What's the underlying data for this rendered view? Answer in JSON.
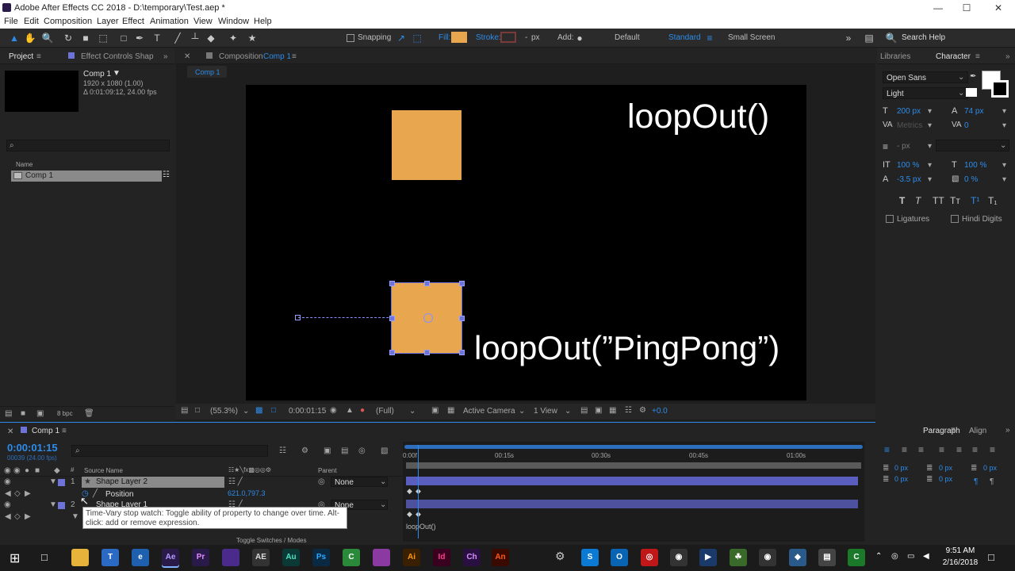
{
  "window": {
    "title": "Adobe After Effects CC 2018 - D:\\temporary\\Test.aep *",
    "min": "—",
    "max": "☐",
    "close": "✕"
  },
  "menu": [
    "File",
    "Edit",
    "Composition",
    "Layer",
    "Effect",
    "Animation",
    "View",
    "Window",
    "Help"
  ],
  "toolbar": {
    "snapping": "Snapping",
    "fill": "Fill:",
    "stroke": "Stroke:",
    "px": "px",
    "add": "Add:",
    "workspaces": [
      "Default",
      "Standard",
      "Small Screen"
    ],
    "active_workspace": "Standard",
    "search_help": "Search Help",
    "fill_color": "#e8a74e"
  },
  "project": {
    "tab_project": "Project",
    "tab_effect": "Effect Controls Shap",
    "comp_name": "Comp 1",
    "comp_res": "1920 x 1080 (1.00)",
    "comp_dur": "Δ 0:01:09:12, 24.00 fps",
    "name_col": "Name",
    "item": "Comp 1",
    "bpc": "8 bpc"
  },
  "composition": {
    "tab": "Composition",
    "tab_comp": "Comp 1",
    "subtab": "Comp 1",
    "text1": "loopOut()",
    "text2": "loopOut(”PingPong”)",
    "zoom": "(55.3%)",
    "timecode": "0:00:01:15",
    "res": "(Full)",
    "camera": "Active Camera",
    "views": "1 View",
    "exposure": "+0.0"
  },
  "character": {
    "tab_libraries": "Libraries",
    "tab_character": "Character",
    "font": "Open Sans",
    "style": "Light",
    "size": "200 px",
    "leading": "74 px",
    "kerning": "Metrics",
    "tracking": "0",
    "stroke_w": "- px",
    "vscale": "100 %",
    "hscale": "100 %",
    "baseline": "-3.5 px",
    "tsume": "0 %",
    "ligatures": "Ligatures",
    "hindi": "Hindi Digits"
  },
  "paragraph": {
    "tab_paragraph": "Paragraph",
    "tab_align": "Align",
    "v1": "0 px",
    "v2": "0 px",
    "v3": "0 px",
    "v4": "0 px",
    "v5": "0 px"
  },
  "timeline": {
    "tab": "Comp 1",
    "timecode": "0:00:01:15",
    "subtc": "00039 (24.00 fps)",
    "col_source": "Source Name",
    "col_parent": "Parent",
    "layers": [
      {
        "num": "1",
        "name": "Shape Layer 2",
        "parent": "None"
      },
      {
        "num": "2",
        "name": "Shape Layer 1",
        "parent": "None"
      }
    ],
    "position_label": "Position",
    "position_value": "621.0,797.3",
    "ruler": [
      "0:00f",
      "00:15s",
      "00:30s",
      "00:45s",
      "01:00s"
    ],
    "expression": "loopOut()",
    "toggle": "Toggle Switches / Modes",
    "tooltip": "Time-Vary stop watch: Toggle ability of property to change over time. Alt-click: add or remove expression."
  },
  "taskbar": {
    "time": "9:51 AM",
    "date": "2/16/2018",
    "apps": [
      {
        "name": "Ae",
        "color": "#2a1a4a",
        "fg": "#b49cff"
      },
      {
        "name": "Pr",
        "color": "#2a1a4a",
        "fg": "#e28cff"
      },
      {
        "name": "",
        "color": "#4a2a8a",
        "fg": "#fff"
      },
      {
        "name": "AE",
        "color": "#333",
        "fg": "#ddd"
      },
      {
        "name": "Au",
        "color": "#0b3a36",
        "fg": "#4fe0c6"
      },
      {
        "name": "Ps",
        "color": "#0a2a44",
        "fg": "#31a8ff"
      },
      {
        "name": "C",
        "color": "#2a8a3a",
        "fg": "#fff"
      },
      {
        "name": "",
        "color": "#8a3aa0",
        "fg": "#fff"
      },
      {
        "name": "Ai",
        "color": "#3a2000",
        "fg": "#ff9a00"
      },
      {
        "name": "Id",
        "color": "#3a0020",
        "fg": "#ff3b8c"
      },
      {
        "name": "Ch",
        "color": "#2a1040",
        "fg": "#d88cff"
      },
      {
        "name": "An",
        "color": "#3a0a00",
        "fg": "#ff5a1a"
      }
    ]
  }
}
